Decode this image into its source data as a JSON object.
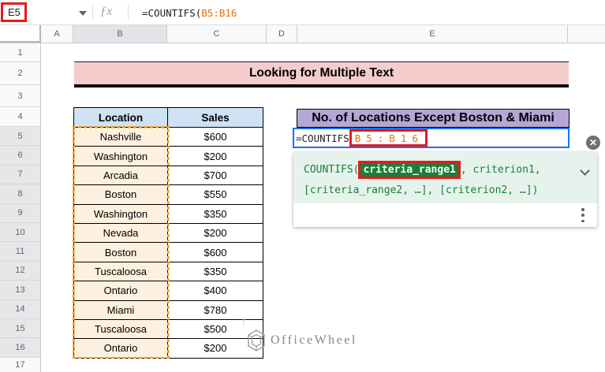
{
  "formula_bar": {
    "name_box": "E5",
    "fx_label": "ƒx",
    "formula_prefix": "=COUNTIFS(",
    "formula_range": "B5:B16"
  },
  "column_headers": [
    "A",
    "B",
    "C",
    "D",
    "E",
    ""
  ],
  "row_headers": [
    "1",
    "2",
    "3",
    "4",
    "5",
    "6",
    "7",
    "8",
    "9",
    "10",
    "11",
    "12",
    "13",
    "14",
    "15",
    "16",
    "17"
  ],
  "banner": {
    "title": "Looking for Multiple Text"
  },
  "table": {
    "headers": [
      "Location",
      "Sales"
    ],
    "rows": [
      [
        "Nashville",
        "$600"
      ],
      [
        "Washington",
        "$200"
      ],
      [
        "Arcadia",
        "$700"
      ],
      [
        "Boston",
        "$550"
      ],
      [
        "Washington",
        "$350"
      ],
      [
        "Nevada",
        "$200"
      ],
      [
        "Boston",
        "$600"
      ],
      [
        "Tuscaloosa",
        "$350"
      ],
      [
        "Ontario",
        "$400"
      ],
      [
        "Miami",
        "$780"
      ],
      [
        "Tuscaloosa",
        "$500"
      ],
      [
        "Ontario",
        "$200"
      ]
    ]
  },
  "e_column": {
    "header": "No. of Locations Except Boston & Miami",
    "cell_formula_prefix": "=COUNTIFS",
    "cell_formula_range": "B5:B16"
  },
  "popup": {
    "line1_prefix": "COUNTIFS(",
    "chip": "criteria_range1",
    "line1_suffix": ", criterion1,",
    "line2": "[criteria_range2, …], [criterion2, …])",
    "close_label": "✕"
  },
  "watermark": {
    "text": "OfficeWheel",
    "tick": "I'"
  },
  "colors": {
    "annot-red": "#e51b1e",
    "edit-blue": "#1a73e8",
    "range-orange": "#e8710a",
    "chip-green": "#188038",
    "popup-green": "#188038",
    "popup-green-bg": "#e6f3ec",
    "banner-pink": "#f4cccc",
    "purple": "#b4a7d6",
    "header-blue": "#cfe2f3",
    "cell-cream": "#fdf0de",
    "dash-orange": "#ff9900"
  }
}
